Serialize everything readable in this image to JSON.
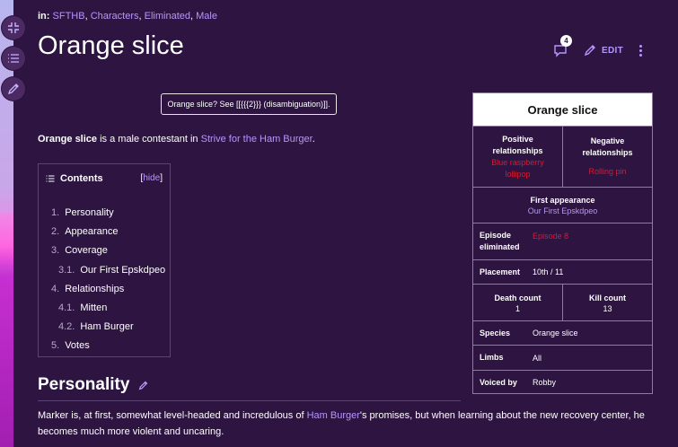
{
  "categories": {
    "prefix": "in:",
    "items": [
      "SFTHB",
      "Characters",
      "Eliminated",
      "Male"
    ]
  },
  "page": {
    "title": "Orange slice",
    "talk_count": "4",
    "edit_label": "EDIT"
  },
  "disambig": "Orange slice? See [[{{{2}}} (disambiguation)]].",
  "intro": {
    "bold": "Orange slice",
    "text1": " is a male contestant in ",
    "link": "Strive for the Ham Burger",
    "text2": "."
  },
  "toc": {
    "title": "Contents",
    "hide_open": "[",
    "hide": "hide",
    "hide_close": "]",
    "items": [
      {
        "num": "1.",
        "label": "Personality"
      },
      {
        "num": "2.",
        "label": "Appearance"
      },
      {
        "num": "3.",
        "label": "Coverage"
      },
      {
        "num": "3.1.",
        "label": "Our First Epskdpeo"
      },
      {
        "num": "4.",
        "label": "Relationships"
      },
      {
        "num": "4.1.",
        "label": "Mitten"
      },
      {
        "num": "4.2.",
        "label": "Ham Burger"
      },
      {
        "num": "5.",
        "label": "Votes"
      }
    ]
  },
  "section": {
    "heading": "Personality",
    "p1": "Marker is, at first, somewhat level-headed and incredulous of ",
    "link": "Ham Burger",
    "p2": "'s promises, but when learning about the new recovery center, he",
    "p3": "becomes much more violent and uncaring."
  },
  "infobox": {
    "title": "Orange slice",
    "positive_label": "Positive relationships",
    "positive_value": "Blue raspberry lollipop",
    "negative_label": "Negative relationships",
    "negative_value": "Rolling pin",
    "first_app_label": "First appearance",
    "first_app_value": "Our First Epskdpeo",
    "episode_label": "Episode eliminated",
    "episode_value": "Episode 8",
    "placement_label": "Placement",
    "placement_value": "10th / 11",
    "death_label": "Death count",
    "death_value": "1",
    "kill_label": "Kill count",
    "kill_value": "13",
    "species_label": "Species",
    "species_value": "Orange slice",
    "limbs_label": "Limbs",
    "limbs_value": "All",
    "voiced_label": "Voiced by",
    "voiced_value": "Robby"
  },
  "colors": {
    "background": "#2d1441",
    "link": "#b596ff",
    "negative": "#d81b30"
  }
}
